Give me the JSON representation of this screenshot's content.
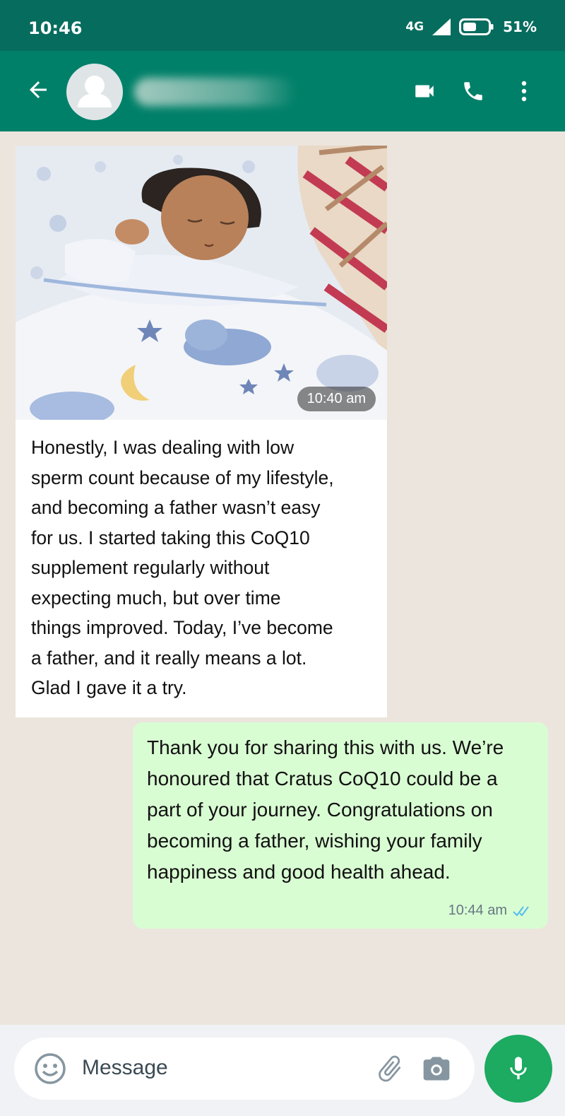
{
  "status_bar": {
    "time": "10:46",
    "network": "4G",
    "battery": "51%"
  },
  "header": {
    "back_icon": "arrow-back-icon",
    "avatar_icon": "default-avatar-icon",
    "contact_name_blurred": true,
    "icons": [
      "video-call-icon",
      "phone-icon",
      "more-vert-icon"
    ]
  },
  "messages": [
    {
      "direction": "incoming",
      "image": "newborn-baby-photo",
      "image_time": "10:40 am",
      "lines": [
        "Honestly, I was dealing with low",
        "sperm count because of my lifestyle,",
        "and becoming a father wasn’t easy",
        "for us. I started taking this CoQ10",
        "supplement regularly without",
        "expecting much, but over time",
        "things improved. Today, I’ve become",
        "a father, and it really means a lot.",
        "Glad I gave it a try."
      ]
    },
    {
      "direction": "outgoing",
      "lines": [
        "Thank you for sharing this with us. We’re",
        "honoured that Cratus CoQ10 could be a",
        "part of your journey. Congratulations on",
        "becoming a father, wishing your family",
        "happiness and good health ahead."
      ],
      "time": "10:44 am",
      "status_icon": "double-check-read-icon"
    }
  ],
  "composer": {
    "placeholder": "Message",
    "icons": [
      "emoji-icon",
      "attach-icon",
      "camera-icon",
      "mic-icon"
    ]
  },
  "colors": {
    "status_bar": "#066c5e",
    "header": "#008069",
    "chat_bg": "#ece5dd",
    "outgoing_bubble": "#d9fdd3",
    "mic_button": "#1daa61",
    "read_tick": "#53bdeb"
  }
}
